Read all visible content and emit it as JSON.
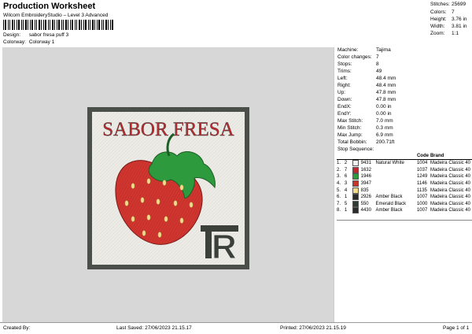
{
  "header": {
    "title": "Production Worksheet",
    "subtitle": "Wilcom EmbroideryStudio – Level 3 Advanced",
    "design_label": "Design:",
    "design_value": "sabor fresa puff 3",
    "colorway_label": "Colorway:",
    "colorway_value": "Colorway 1"
  },
  "stats": [
    {
      "label": "Stitches:",
      "value": "25699"
    },
    {
      "label": "Colors:",
      "value": "7"
    },
    {
      "label": "Height:",
      "value": "3.76 in"
    },
    {
      "label": "Width:",
      "value": "3.81 in"
    },
    {
      "label": "Zoom:",
      "value": "1:1"
    }
  ],
  "specs": [
    {
      "label": "Machine:",
      "value": "Tajima"
    },
    {
      "label": "Color changes:",
      "value": "7"
    },
    {
      "label": "Stops:",
      "value": "8"
    },
    {
      "label": "Trims:",
      "value": "49"
    },
    {
      "label": "Left:",
      "value": "48.4 mm"
    },
    {
      "label": "Right:",
      "value": "48.4 mm"
    },
    {
      "label": "Up:",
      "value": "47.8 mm"
    },
    {
      "label": "Down:",
      "value": "47.8 mm"
    },
    {
      "label": "EndX:",
      "value": "0.00 in"
    },
    {
      "label": "EndY:",
      "value": "0.00 in"
    },
    {
      "label": "Max Stitch:",
      "value": "7.0 mm"
    },
    {
      "label": "Min Stitch:",
      "value": "0.3 mm"
    },
    {
      "label": "Max Jump:",
      "value": "6.9 mm"
    },
    {
      "label": "Total Bobbin:",
      "value": "200.71ft"
    }
  ],
  "sequence": {
    "title": "Stop Sequence:",
    "headers": [
      "Code",
      "Brand"
    ],
    "rows": [
      {
        "stop": "1.",
        "n": "2",
        "color": "#f2f2ef",
        "num": "9431",
        "name": "Natural White",
        "code": "1004",
        "brand": "Madeira Classic 40"
      },
      {
        "stop": "2.",
        "n": "7",
        "color": "#c0282d",
        "num": "1632",
        "name": "",
        "code": "1037",
        "brand": "Madeira Classic 40"
      },
      {
        "stop": "3.",
        "n": "6",
        "color": "#2e9a3e",
        "num": "1946",
        "name": "",
        "code": "1249",
        "brand": "Madeira Classic 40"
      },
      {
        "stop": "4.",
        "n": "3",
        "color": "#c8352e",
        "num": "3947",
        "name": "",
        "code": "1146",
        "brand": "Madeira Classic 40"
      },
      {
        "stop": "5.",
        "n": "4",
        "color": "#f3d98a",
        "num": "835",
        "name": "",
        "code": "1135",
        "brand": "Madeira Classic 40"
      },
      {
        "stop": "6.",
        "n": "1",
        "color": "#2a2a2a",
        "num": "2926",
        "name": "Amber Black",
        "code": "1007",
        "brand": "Madeira Classic 40"
      },
      {
        "stop": "7.",
        "n": "5",
        "color": "#2f3a33",
        "num": "550",
        "name": "Emerald Black",
        "code": "1000",
        "brand": "Madeira Classic 40"
      },
      {
        "stop": "8.",
        "n": "1",
        "color": "#2a2a2a",
        "num": "4430",
        "name": "Amber Black",
        "code": "1007",
        "brand": "Madeira Classic 40"
      }
    ]
  },
  "design": {
    "text": "SABOR FRESA",
    "monogram": "R"
  },
  "footer": {
    "created": "Created By:",
    "saved": "Last Saved: 27/06/2023 21.15.17",
    "printed": "Printed: 27/06/2023 21.15.19",
    "page": "Page 1 of 1"
  }
}
